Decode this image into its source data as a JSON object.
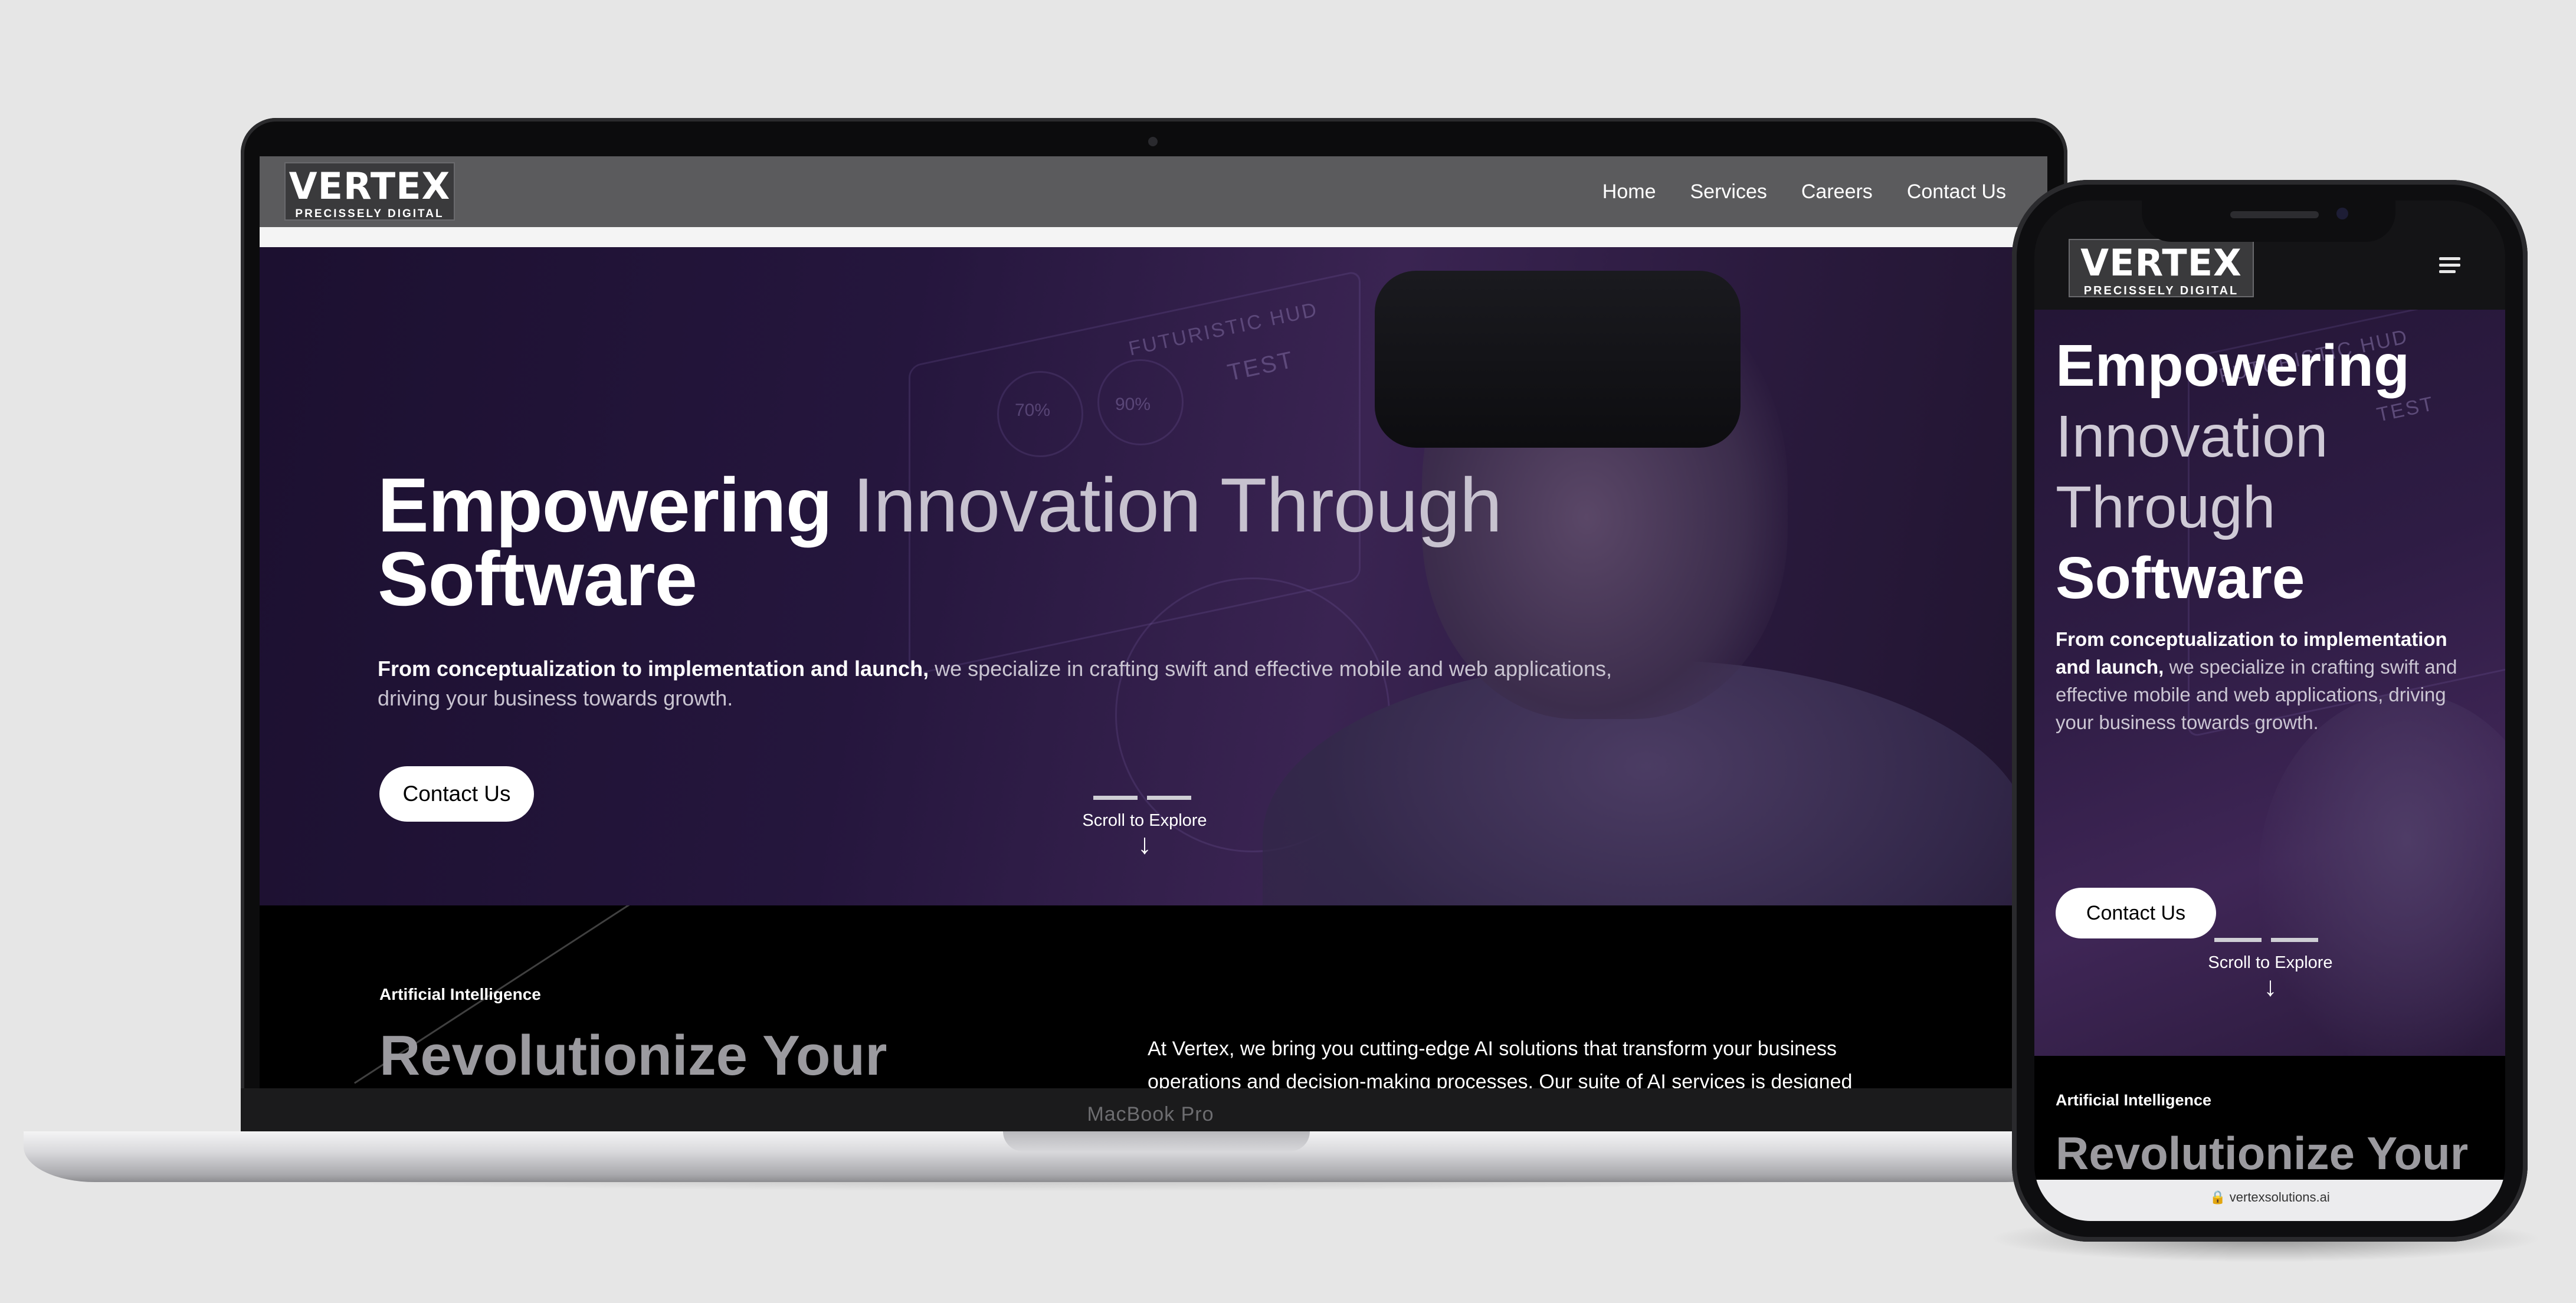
{
  "brand": {
    "logo_main": "VERTEX",
    "logo_sub": "PRECISSELY DIGITAL"
  },
  "laptop": {
    "model_label": "MacBook Pro",
    "nav": {
      "items": [
        "Home",
        "Services",
        "Careers",
        "Contact Us"
      ]
    },
    "hero": {
      "title_bold_1": "Empowering",
      "title_light": "Innovation Through",
      "title_bold_2": "Software",
      "desc_bold": "From conceptualization to implementation and launch,",
      "desc_rest": "we specialize in crafting swift and effective mobile and web applications, driving your business towards growth.",
      "cta_label": "Contact Us",
      "scroll_label": "Scroll to Explore",
      "scroll_arrow": "↓"
    },
    "section": {
      "kicker": "Artificial Intelligence",
      "heading": "Revolutionize Your",
      "body": "At Vertex, we bring you cutting-edge AI solutions that transform your business operations and decision-making processes. Our suite of AI services is designed"
    },
    "hud_labels": [
      "FUTURISTIC HUD",
      "TEST",
      "70%",
      "90%"
    ]
  },
  "phone": {
    "hero": {
      "title_bold_1": "Empowering",
      "title_light_1": "Innovation",
      "title_light_2": "Through",
      "title_bold_2": "Software",
      "desc_bold": "From conceptualization to implementation and launch,",
      "desc_rest": "we specialize in crafting swift and effective mobile and web applications, driving your business towards growth.",
      "cta_label": "Contact Us",
      "scroll_label": "Scroll to Explore",
      "scroll_arrow": "↓"
    },
    "section": {
      "kicker": "Artificial Intelligence",
      "heading": "Revolutionize Your"
    },
    "url": "🔒 vertexsolutions.ai",
    "hud_labels": [
      "FUTURISTIC HUD",
      "TEST"
    ]
  },
  "colors": {
    "background": "#e6e6e6",
    "hero_purple": "#25163d",
    "nav_gray": "#5b5b5d",
    "button_white": "#ffffff"
  }
}
